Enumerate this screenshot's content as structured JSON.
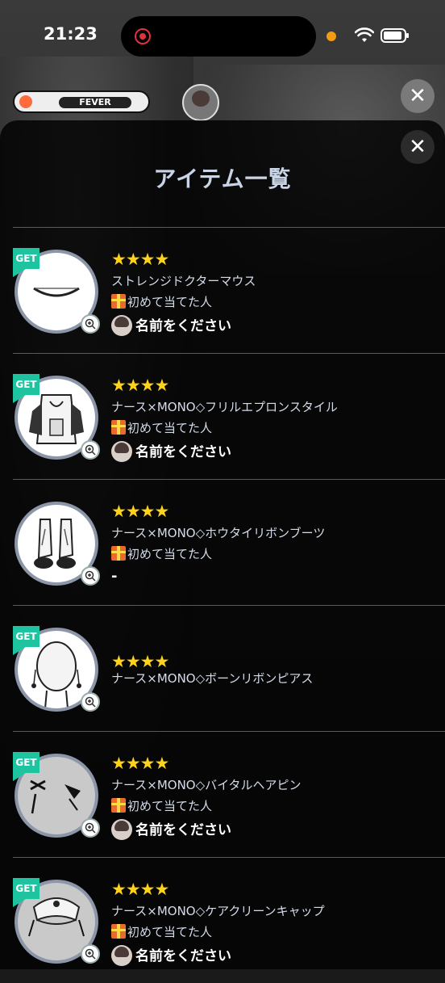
{
  "status_bar": {
    "time": "21:23"
  },
  "hud": {
    "fever_label": "FEVER"
  },
  "modal": {
    "title": "アイテム一覧",
    "close_symbol": "✕"
  },
  "items": [
    {
      "stars": "★★★★",
      "name": "ストレンジドクターマウス",
      "first_label": "初めて当てた人",
      "owner": "名前をください",
      "get": true
    },
    {
      "stars": "★★★★",
      "name": "ナース×MONO◇フリルエプロンスタイル",
      "first_label": "初めて当てた人",
      "owner": "名前をください",
      "get": true
    },
    {
      "stars": "★★★★",
      "name": "ナース×MONO◇ホウタイリボンブーツ",
      "first_label": "初めて当てた人",
      "owner": "-",
      "get": false
    },
    {
      "stars": "★★★★",
      "name": "ナース×MONO◇ボーンリボンピアス",
      "first_label": "",
      "owner": "",
      "get": true
    },
    {
      "stars": "★★★★",
      "name": "ナース×MONO◇バイタルヘアピン",
      "first_label": "初めて当てた人",
      "owner": "名前をください",
      "get": true
    },
    {
      "stars": "★★★★",
      "name": "ナース×MONO◇ケアクリーンキャップ",
      "first_label": "初めて当てた人",
      "owner": "名前をください",
      "get": true
    }
  ],
  "badges": {
    "get_label": "GET"
  },
  "icons": [
    "wifi-icon",
    "battery-icon",
    "close-icon",
    "gift-icon",
    "zoom-in-icon",
    "star-icon"
  ]
}
